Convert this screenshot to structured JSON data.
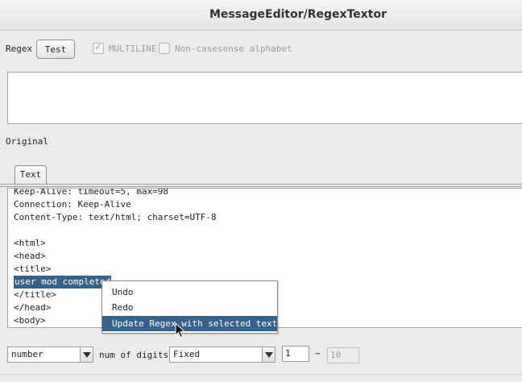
{
  "window": {
    "title": "MessageEditor/RegexTextor"
  },
  "regex": {
    "label": "Regex",
    "test_button": "Test",
    "multiline_label": "MULTILINE",
    "multiline_checked": true,
    "noncase_label": "Non-casesense alphabet",
    "noncase_checked": false,
    "value": ""
  },
  "original": {
    "label": "Original",
    "tab_label": "Text",
    "lines": [
      "Keep-Alive: timeout=5, max=98",
      "Connection: Keep-Alive",
      "Content-Type: text/html; charset=UTF-8",
      "",
      "<html>",
      "<head>",
      "<title>",
      "user mod completed",
      "</title>",
      "</head>",
      "<body>"
    ],
    "selected_text": "user mod completed"
  },
  "context_menu": {
    "items": [
      "Undo",
      "Redo",
      "Update Regex with selected text."
    ],
    "highlighted_index": 2
  },
  "bottom": {
    "type_select": "number",
    "digits_label": "num of digits",
    "digits_select": "Fixed",
    "min_value": "1",
    "tilde": "~",
    "max_value": "10"
  },
  "colors": {
    "selection": "#35618a",
    "tab_rule": "#8aa0b4"
  },
  "icons": {
    "cursor": "mouse-pointer-icon",
    "checkbox": "check-icon",
    "dropdown": "chevron-down-icon"
  }
}
